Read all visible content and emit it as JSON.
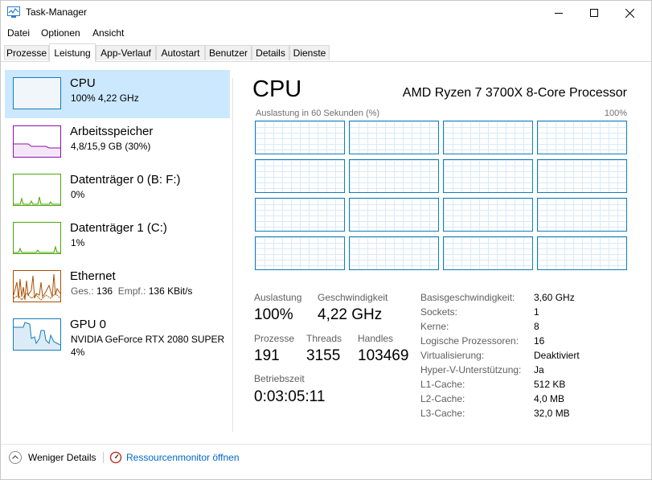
{
  "window": {
    "title": "Task-Manager"
  },
  "menu": [
    "Datei",
    "Optionen",
    "Ansicht"
  ],
  "tabs": [
    "Prozesse",
    "Leistung",
    "App-Verlauf",
    "Autostart",
    "Benutzer",
    "Details",
    "Dienste"
  ],
  "active_tab": "Leistung",
  "sidebar": [
    {
      "title": "CPU",
      "sub": "100%  4,22 GHz",
      "sub2": "",
      "color": "#117dbb"
    },
    {
      "title": "Arbeitsspeicher",
      "sub": "4,8/15,9 GB (30%)",
      "sub2": "",
      "color": "#8b12ae"
    },
    {
      "title": "Datenträger 0 (B: F:)",
      "sub": "0%",
      "sub2": "",
      "color": "#4da60c"
    },
    {
      "title": "Datenträger 1 (C:)",
      "sub": "1%",
      "sub2": "",
      "color": "#4da60c"
    },
    {
      "title": "Ethernet",
      "sub_label_a": "Ges.: ",
      "sub_value_a": "136",
      "sub_label_b": "  Empf.: ",
      "sub_value_b": "136 KBit/s",
      "sub": "",
      "sub2": "",
      "color": "#a74f01"
    },
    {
      "title": "GPU 0",
      "sub": "NVIDIA GeForce RTX 2080 SUPER",
      "sub2": "4%",
      "color": "#117dbb"
    }
  ],
  "main": {
    "title": "CPU",
    "processor": "AMD Ryzen 7 3700X 8-Core Processor",
    "graph_caption": "Auslastung in 60 Sekunden (%)",
    "graph_max": "100%",
    "stats": {
      "auslastung_label": "Auslastung",
      "auslastung": "100%",
      "geschwindigkeit_label": "Geschwindigkeit",
      "geschwindigkeit": "4,22 GHz",
      "prozesse_label": "Prozesse",
      "prozesse": "191",
      "threads_label": "Threads",
      "threads": "3155",
      "handles_label": "Handles",
      "handles": "103469",
      "betriebszeit_label": "Betriebszeit",
      "betriebszeit": "0:03:05:11"
    },
    "info": [
      {
        "label": "Basisgeschwindigkeit:",
        "value": "3,60 GHz"
      },
      {
        "label": "Sockets:",
        "value": "1"
      },
      {
        "label": "Kerne:",
        "value": "8"
      },
      {
        "label": "Logische Prozessoren:",
        "value": "16"
      },
      {
        "label": "Virtualisierung:",
        "value": "Deaktiviert"
      },
      {
        "label": "Hyper-V-Unterstützung:",
        "value": "Ja"
      },
      {
        "label": "L1-Cache:",
        "value": "512 KB"
      },
      {
        "label": "L2-Cache:",
        "value": "4,0 MB"
      },
      {
        "label": "L3-Cache:",
        "value": "32,0 MB"
      }
    ]
  },
  "footer": {
    "fewer_details": "Weniger Details",
    "resource_monitor": "Ressourcenmonitor öffnen"
  },
  "colors": {
    "selected_bg": "#cce8ff",
    "cpu_blue": "#117dbb",
    "memory_purple": "#8b12ae",
    "disk_green": "#4da60c",
    "ethernet_orange": "#a74f01",
    "link_blue": "#0066cc"
  }
}
